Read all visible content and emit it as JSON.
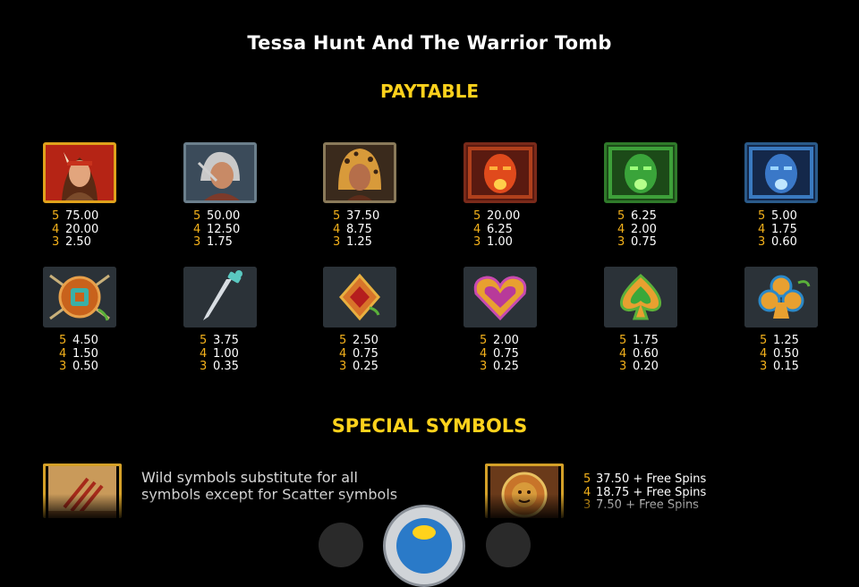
{
  "game_title": "Tessa Hunt And The Warrior Tomb",
  "paytable_title": "PAYTABLE",
  "special_title": "SPECIAL SYMBOLS",
  "symbols": [
    {
      "icon": "tessa-hunt-icon",
      "pays": [
        {
          "n": "5",
          "v": "75.00"
        },
        {
          "n": "4",
          "v": "20.00"
        },
        {
          "n": "3",
          "v": "2.50"
        }
      ]
    },
    {
      "icon": "old-warrior-icon",
      "pays": [
        {
          "n": "5",
          "v": "50.00"
        },
        {
          "n": "4",
          "v": "12.50"
        },
        {
          "n": "3",
          "v": "1.75"
        }
      ]
    },
    {
      "icon": "jaguar-warrior-icon",
      "pays": [
        {
          "n": "5",
          "v": "37.50"
        },
        {
          "n": "4",
          "v": "8.75"
        },
        {
          "n": "3",
          "v": "1.25"
        }
      ]
    },
    {
      "icon": "red-mask-icon",
      "pays": [
        {
          "n": "5",
          "v": "20.00"
        },
        {
          "n": "4",
          "v": "6.25"
        },
        {
          "n": "3",
          "v": "1.00"
        }
      ]
    },
    {
      "icon": "green-mask-icon",
      "pays": [
        {
          "n": "5",
          "v": "6.25"
        },
        {
          "n": "4",
          "v": "2.00"
        },
        {
          "n": "3",
          "v": "0.75"
        }
      ]
    },
    {
      "icon": "blue-mask-icon",
      "pays": [
        {
          "n": "5",
          "v": "5.00"
        },
        {
          "n": "4",
          "v": "1.75"
        },
        {
          "n": "3",
          "v": "0.60"
        }
      ]
    },
    {
      "icon": "shield-icon",
      "pays": [
        {
          "n": "5",
          "v": "4.50"
        },
        {
          "n": "4",
          "v": "1.50"
        },
        {
          "n": "3",
          "v": "0.50"
        }
      ]
    },
    {
      "icon": "dagger-icon",
      "pays": [
        {
          "n": "5",
          "v": "3.75"
        },
        {
          "n": "4",
          "v": "1.00"
        },
        {
          "n": "3",
          "v": "0.35"
        }
      ]
    },
    {
      "icon": "diamond-icon",
      "pays": [
        {
          "n": "5",
          "v": "2.50"
        },
        {
          "n": "4",
          "v": "0.75"
        },
        {
          "n": "3",
          "v": "0.25"
        }
      ]
    },
    {
      "icon": "heart-icon",
      "pays": [
        {
          "n": "5",
          "v": "2.00"
        },
        {
          "n": "4",
          "v": "0.75"
        },
        {
          "n": "3",
          "v": "0.25"
        }
      ]
    },
    {
      "icon": "spade-icon",
      "pays": [
        {
          "n": "5",
          "v": "1.75"
        },
        {
          "n": "4",
          "v": "0.60"
        },
        {
          "n": "3",
          "v": "0.20"
        }
      ]
    },
    {
      "icon": "club-icon",
      "pays": [
        {
          "n": "5",
          "v": "1.25"
        },
        {
          "n": "4",
          "v": "0.50"
        },
        {
          "n": "3",
          "v": "0.15"
        }
      ]
    }
  ],
  "wild": {
    "icon": "wild-icon",
    "text": "Wild symbols substitute for all symbols except for Scatter symbols"
  },
  "scatter": {
    "icon": "scatter-icon",
    "pays": [
      {
        "n": "5",
        "v": "37.50 + Free Spins"
      },
      {
        "n": "4",
        "v": "18.75 + Free Spins"
      },
      {
        "n": "3",
        "v": "7.50 + Free Spins"
      }
    ]
  },
  "controls": {
    "prev": "prev-page-button",
    "home": "home-button",
    "next": "next-page-button"
  }
}
